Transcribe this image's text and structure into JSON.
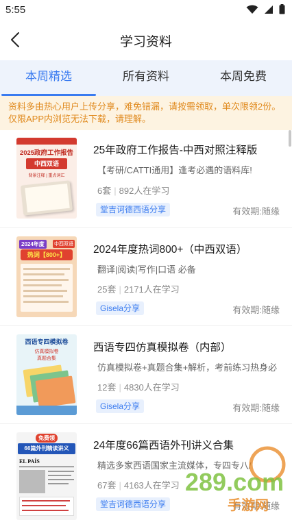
{
  "status_bar": {
    "time": "5:55"
  },
  "header": {
    "title": "学习资料"
  },
  "tabs": [
    {
      "label": "本周精选",
      "active": true
    },
    {
      "label": "所有资料",
      "active": false
    },
    {
      "label": "本周免费",
      "active": false
    }
  ],
  "notice": {
    "line1": "资料多由热心用户上传分享，难免错漏，请按需领取，单次限领2份。",
    "line2": "仅限APP内浏览无法下载，请理解。"
  },
  "items": [
    {
      "title": "25年政府工作报告-中西对照注释版",
      "desc": "【考研/CATTI通用】逢考必遇的语料库!",
      "sets": "6套",
      "learners": "892人在学习",
      "tag": "堂吉诃德西语分享",
      "validity": "有效期:随缘",
      "cover": {
        "line1": "2025政府工作报告",
        "line2": "中西双语",
        "line3": "背景注释 | 重点词汇"
      }
    },
    {
      "title": "2024年度热词800+（中西双语）",
      "desc": "翻译|阅读|写作|口语 必备",
      "sets": "25套",
      "learners": "2171人在学习",
      "tag": "Gisela分享",
      "validity": "有效期:随缘",
      "cover": {
        "line1": "2024年度",
        "line2": "热词【800+】",
        "line3": "中西双语"
      }
    },
    {
      "title": "西语专四仿真模拟卷（内部）",
      "desc": "仿真模拟卷+真题合集+解析，考前练习热身必",
      "sets": "12套",
      "learners": "4830人在学习",
      "tag": "Gisela分享",
      "validity": "有效期:随缘",
      "cover": {
        "line1": "西语专四模拟卷",
        "line2": "仿真模拟卷",
        "line3": "真题合集"
      }
    },
    {
      "title": "24年度66篇西语外刊讲义合集",
      "desc": "精选多家西语国家主流媒体，专四专八/",
      "sets": "67套",
      "learners": "4163人在学习",
      "tag": "堂吉诃德西语分享",
      "validity": "有效期:随缘",
      "cover": {
        "line1": "免费领",
        "line2": "66篇外刊精读讲义",
        "line3": "EL PAÍS"
      }
    }
  ],
  "watermark": {
    "text": "289.com",
    "subtext": "手游网"
  },
  "colors": {
    "accent": "#3a7bf0",
    "notice_text": "#e08a1e",
    "notice_bg": "#fdf3e1",
    "tab_bg": "#eef3fc"
  }
}
